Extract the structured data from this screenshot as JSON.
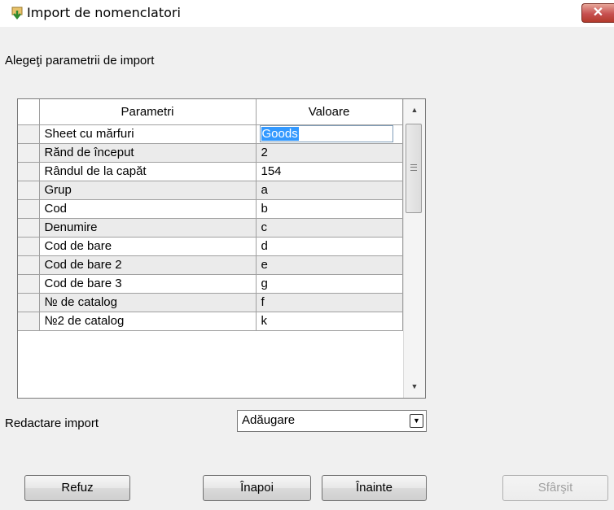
{
  "window": {
    "title": "Import de nomenclatori",
    "close_label": "✕"
  },
  "subtitle": "Alegeţi parametrii de import",
  "grid": {
    "headers": {
      "param": "Parametri",
      "value": "Valoare"
    },
    "rows": [
      {
        "param": "Sheet cu mărfuri",
        "value": "Goods"
      },
      {
        "param": "Rănd de început",
        "value": "2"
      },
      {
        "param": "Rândul de la capăt",
        "value": "154"
      },
      {
        "param": "Grup",
        "value": "a"
      },
      {
        "param": "Cod",
        "value": "b"
      },
      {
        "param": "Denumire",
        "value": "c"
      },
      {
        "param": "Cod de bare",
        "value": "d"
      },
      {
        "param": "Cod de bare 2",
        "value": "e"
      },
      {
        "param": "Cod de bare 3",
        "value": "g"
      },
      {
        "param": "№ de catalog",
        "value": "f"
      },
      {
        "param": "№2 de catalog",
        "value": "k"
      }
    ]
  },
  "redact": {
    "label": "Redactare import",
    "value": "Adăugare"
  },
  "buttons": {
    "cancel": "Refuz",
    "back": "Înapoi",
    "next": "Înainte",
    "finish": "Sfârşit"
  },
  "icons": {
    "app": "import-arrow-icon",
    "scroll_up": "▲",
    "scroll_down": "▼",
    "combo": "▼"
  }
}
